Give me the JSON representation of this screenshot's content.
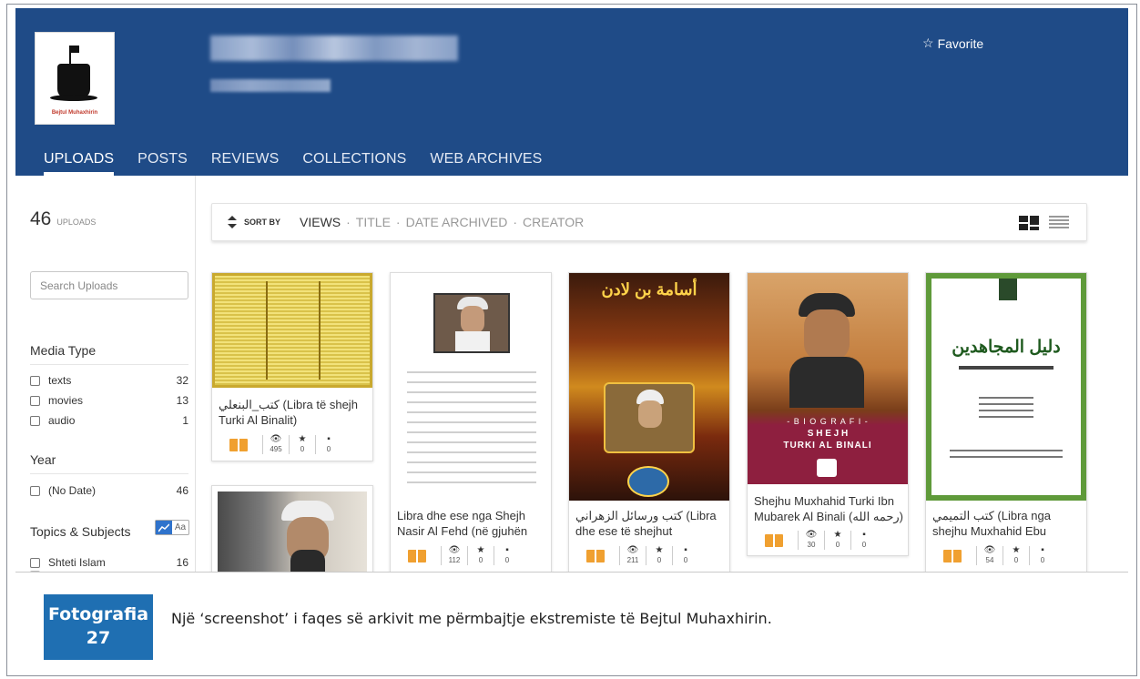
{
  "header": {
    "logo_text": "Bejtul Muhaxhirin",
    "favorite_label": "Favorite",
    "colors": {
      "header_bg": "#1f4b87",
      "accent_orange": "#f0a030",
      "caption_blue": "#1f6fb2"
    }
  },
  "tabs": [
    {
      "label": "UPLOADS",
      "active": true
    },
    {
      "label": "POSTS"
    },
    {
      "label": "REVIEWS"
    },
    {
      "label": "COLLECTIONS"
    },
    {
      "label": "WEB ARCHIVES"
    }
  ],
  "sidebar": {
    "count": "46",
    "count_label": "UPLOADS",
    "search_placeholder": "Search Uploads",
    "media_type": {
      "heading": "Media Type",
      "items": [
        {
          "label": "texts",
          "count": "32"
        },
        {
          "label": "movies",
          "count": "13"
        },
        {
          "label": "audio",
          "count": "1"
        }
      ]
    },
    "year": {
      "heading": "Year",
      "items": [
        {
          "label": "(No Date)",
          "count": "46"
        }
      ]
    },
    "topics": {
      "heading": "Topics & Subjects",
      "toggle_text": "Aa",
      "items": [
        {
          "label": "Shteti Islam",
          "count": "16"
        }
      ]
    }
  },
  "sortbar": {
    "label": "SORT BY",
    "options": [
      "VIEWS",
      "TITLE",
      "DATE ARCHIVED",
      "CREATOR"
    ],
    "separator": "·"
  },
  "tiles": [
    {
      "title": "كتب_البنعلي (Libra të shejh Turki Al Binalit)",
      "views": "495",
      "favs": "0",
      "reviews": "0"
    },
    {
      "title": "Libra dhe ese nga Shejh Nasir Al Fehd (në gjuhën",
      "views": "112",
      "favs": "0",
      "reviews": "0"
    },
    {
      "title": "كتب ورسائل الزهراني (Libra dhe ese të shejhut",
      "views": "211",
      "favs": "0",
      "reviews": "0"
    },
    {
      "title": "Shejhu Muxhahid Turki Ibn Mubarek Al Binali (رحمه الله)",
      "views": "30",
      "favs": "0",
      "reviews": "0"
    },
    {
      "title": "كتب التميمي (Libra nga shejhu Muxhahid Ebu",
      "views": "54",
      "favs": "0",
      "reviews": "0"
    }
  ],
  "cover_texts": {
    "tile3_top": "أسامة بن لادن",
    "tile4_band1": "- B I O G R A F I -",
    "tile4_band2": "S H E J H",
    "tile4_band3": "TURKI AL BINALI",
    "tile5_title": "دليل المجاهدين"
  },
  "caption": {
    "label_line1": "Fotografia",
    "label_line2": "27",
    "text": "Një ‘screenshot’ i faqes së arkivit me përmbajtje ekstremiste të Bejtul Muhaxhirin."
  }
}
